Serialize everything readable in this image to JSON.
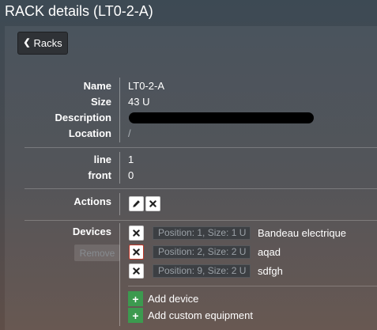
{
  "page": {
    "title": "RACK details (LT0-2-A)",
    "back_label": "Racks"
  },
  "details": {
    "name_label": "Name",
    "name_value": "LT0-2-A",
    "size_label": "Size",
    "size_value": "43 U",
    "description_label": "Description",
    "location_label": "Location",
    "location_value": "/"
  },
  "position": {
    "line_label": "line",
    "line_value": "1",
    "front_label": "front",
    "front_value": "0"
  },
  "actions": {
    "label": "Actions",
    "edit_icon": "pencil-icon",
    "delete_icon": "close-icon"
  },
  "devices": {
    "label": "Devices",
    "remove_label": "Remove",
    "items": [
      {
        "position": "Position: 1, Size: 1 U",
        "name": "Bandeau electrique",
        "delete_icon": "close-icon"
      },
      {
        "position": "Position: 2, Size: 2 U",
        "name": "aqad",
        "delete_icon": "close-icon"
      },
      {
        "position": "Position: 9, Size: 2 U",
        "name": "sdfgh",
        "delete_icon": "close-icon"
      }
    ],
    "add_device_label": "Add device",
    "add_custom_label": "Add custom equipment"
  },
  "colors": {
    "accent_green": "#3c9a4f",
    "danger_red": "#c0392b",
    "background_top": "#3d4a54",
    "background_bottom": "#5f4e48"
  }
}
